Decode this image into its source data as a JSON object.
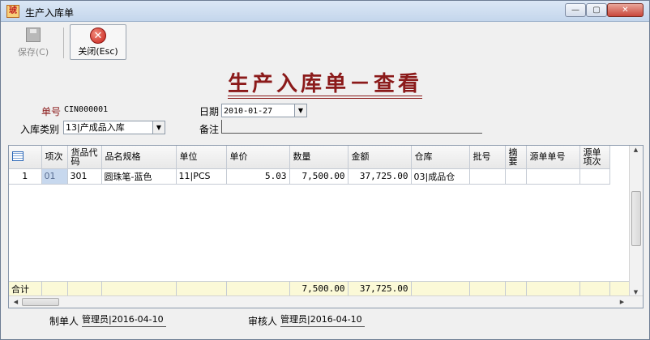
{
  "window": {
    "title": "生产入库单",
    "icon_glyph": "琥",
    "min_glyph": "—",
    "max_glyph": "▢",
    "close_glyph": "✕"
  },
  "toolbar": {
    "save_label": "保存(C)",
    "close_label": "关闭(Esc)",
    "close_glyph": "✕"
  },
  "document": {
    "title": "生产入库单－查看"
  },
  "form": {
    "doc_no_label": "单号",
    "doc_no": "CIN000001",
    "date_label": "日期",
    "date": "2010-01-27",
    "type_label": "入库类别",
    "type_value": "13|产成品入库",
    "remark_label": "备注",
    "remark_value": "",
    "dropdown_glyph": "▼"
  },
  "grid": {
    "columns": [
      "",
      "项次",
      "货品代码",
      "品名规格",
      "单位",
      "单价",
      "数量",
      "金额",
      "仓库",
      "批号",
      "摘要",
      "源单单号",
      "源单项次"
    ],
    "rows": [
      {
        "row_no": "1",
        "item_no": "01",
        "code": "301",
        "name": "圆珠笔-蓝色",
        "unit": "11|PCS",
        "price": "5.03",
        "qty": "7,500.00",
        "amount": "37,725.00",
        "warehouse": "03|成品仓",
        "batch": "",
        "summary": "",
        "src_no": "",
        "src_item": ""
      }
    ],
    "total_label": "合计",
    "total_qty": "7,500.00",
    "total_amount": "37,725.00",
    "scroll_up": "▲",
    "scroll_down": "▼",
    "scroll_left": "◀",
    "scroll_right": "▶"
  },
  "footer": {
    "creator_label": "制单人",
    "creator_value": "管理员|2016-04-10",
    "reviewer_label": "审核人",
    "reviewer_value": "管理员|2016-04-10"
  }
}
